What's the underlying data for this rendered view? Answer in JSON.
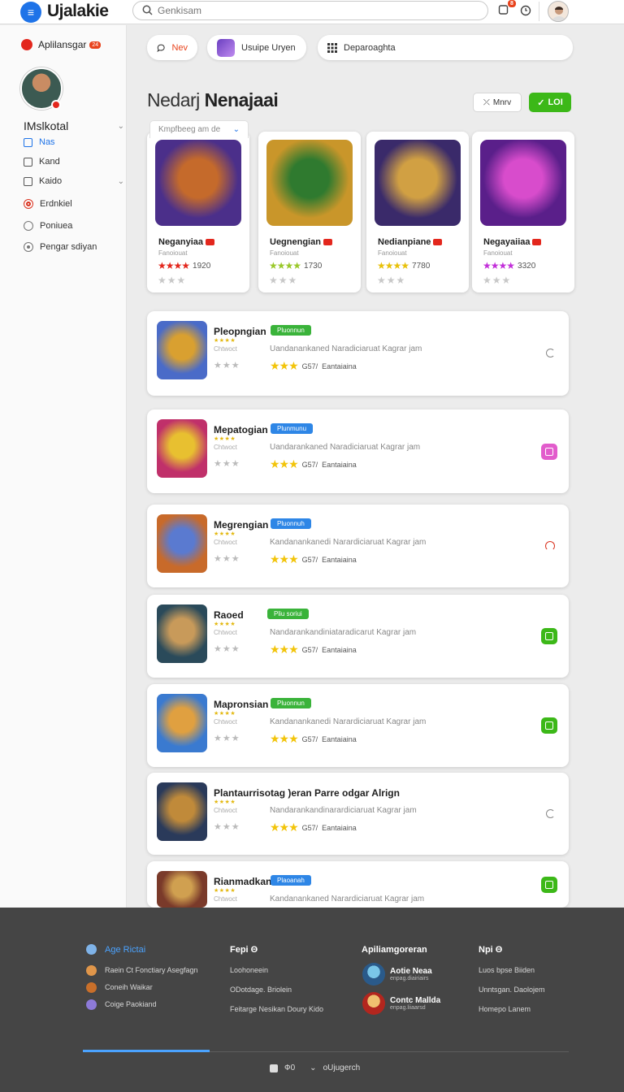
{
  "header": {
    "brand": "Ujalakie",
    "search_placeholder": "Genkisam",
    "notif_badge": "8"
  },
  "sidebar": {
    "app_label": "Aplilansgar",
    "app_badge": "24",
    "user_name": "IMslkotal",
    "items": [
      {
        "label": "Nas",
        "icon": "checkbox-icon",
        "active": true
      },
      {
        "label": "Kand",
        "icon": "checkbox-icon"
      },
      {
        "label": "Kaido",
        "icon": "checkbox-icon",
        "chevron": true
      },
      {
        "label": "Erdnkiel",
        "icon": "record-icon"
      },
      {
        "label": "Poniuea",
        "icon": "circle-icon"
      },
      {
        "label": "Pengar sdiyan",
        "icon": "dot-circle-icon"
      }
    ]
  },
  "filters": {
    "new_label": "Nev",
    "user_label": "Usuipe Uryen",
    "dep_label": "Deparoaghta"
  },
  "section": {
    "title_light": "Nedarj",
    "title_bold": "Nenajaai",
    "view_label": "Mnrv",
    "join_label": "LOI",
    "sort_label": "Kmpfbeeg am de"
  },
  "featured": [
    {
      "title": "Neganyiaa",
      "sub": "Fanoiouat",
      "score": "1920",
      "star_color": "#e3271d",
      "palette": [
        "#4b2f8a",
        "#c56a2b"
      ]
    },
    {
      "title": "Uegnengian",
      "sub": "Fanoiouat",
      "score": "1730",
      "star_color": "#9ac82a",
      "palette": [
        "#c9962a",
        "#2f7a2f"
      ]
    },
    {
      "title": "Nedianpiane",
      "sub": "Fanoiouat",
      "score": "7780",
      "star_color": "#e8c10a",
      "palette": [
        "#3a2a6a",
        "#d1a043"
      ]
    },
    {
      "title": "Negayaiiaa",
      "sub": "Fanoiouat",
      "score": "3320",
      "star_color": "#c22fd9",
      "palette": [
        "#5a1f8a",
        "#d84ccc"
      ]
    }
  ],
  "list": [
    {
      "name": "Pleopngian",
      "tag": "Pluonnun",
      "tag_color": "green",
      "small": "Chtwoct",
      "desc": "Uandanankaned Naradiciaruat Kagrar jam",
      "score": "G57/",
      "rating_label": "Eantaiaina",
      "action": "ring-gray"
    },
    {
      "name": "Mepatogian",
      "tag": "Plunmunu",
      "tag_color": "blue",
      "small": "Chtwoct",
      "desc": "Uandarankaned Naradiciaruat Kagrar jam",
      "score": "G57/",
      "rating_label": "Eantaiaina",
      "action": "btn-pink"
    },
    {
      "name": "Megrengian",
      "tag": "Pluonnuh",
      "tag_color": "blue",
      "small": "Chtwoct",
      "desc": "Kandanankanedi Narardiciaruat Kagrar jam",
      "score": "G57/",
      "rating_label": "Eantaiaina",
      "action": "ring-red"
    },
    {
      "name": "Raoed",
      "tag": "Pliu soriui",
      "tag_color": "green",
      "small": "Chtwoct",
      "desc": "Nandarankandiniataradicarut Kagrar jam",
      "score": "G57/",
      "rating_label": "Eantaiaina",
      "action": "btn-green"
    },
    {
      "name": "Mapronsian",
      "tag": "Pluonnun",
      "tag_color": "green",
      "small": "Chtwoct",
      "desc": "Kandanankanedi Narardiciaruat Kagrar jam",
      "score": "G57/",
      "rating_label": "Eantaiaina",
      "action": "btn-green"
    },
    {
      "name": "Plantaurrisotag )eran Parre odgar Alrign",
      "tag": "",
      "tag_color": "",
      "small": "Chtwoct",
      "desc": "Nandarankandinarardiciaruat Kagrar jam",
      "score": "G57/",
      "rating_label": "Eantaiaina",
      "action": "ring-gray"
    },
    {
      "name": "Rianmadkan",
      "tag": "Plaoanah",
      "tag_color": "blue",
      "small": "Chtwoct",
      "desc": "Kandanankaned Narardiciaruat Kagrar jam",
      "score": "",
      "rating_label": "",
      "action": "btn-green"
    }
  ],
  "footer": {
    "col1": {
      "head": "Age Rictai",
      "links": [
        "Raein Ct Fonctiary Asegfagn",
        "Coneih Waikar",
        "Coige Paokiand"
      ]
    },
    "col2": {
      "head": "Fepi Θ",
      "links": [
        "Loohoneein",
        "ODotdage. Briolein",
        "Feitarge Nesikan Doury Kido"
      ]
    },
    "col3": {
      "head": "Apiliamgoreran",
      "apps": [
        {
          "name": "Aotie Neaa",
          "sub": "enpag.diairiairs"
        },
        {
          "name": "Contc Mallda",
          "sub": "enpag.liiaarsd"
        }
      ]
    },
    "col4": {
      "head": "Npi Θ",
      "links": [
        "Luos bpse Biiden",
        "Unntsgan. Daolojem",
        "Homepo Lanem"
      ]
    },
    "bottom_left": "Ф0",
    "bottom_right": "oUjugerch"
  }
}
